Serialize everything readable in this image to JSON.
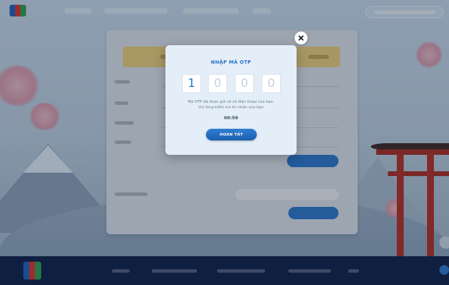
{
  "otp_modal": {
    "title": "NHẬP MÃ OTP",
    "digits": [
      "1",
      "0",
      "0",
      "0"
    ],
    "message_line1": "Mã OTP đã được gửi về số điện thoại của bạn.",
    "message_line2": "Vui lòng kiểm tra tin nhắn của bạn",
    "timer": "00:59",
    "confirm_label": "HOÀN TẤT",
    "close_icon": "close-icon"
  },
  "colors": {
    "accent": "#2a73c4",
    "tab_strip": "#e9c975",
    "footer": "#0d1d44",
    "torii": "#b02d20"
  }
}
